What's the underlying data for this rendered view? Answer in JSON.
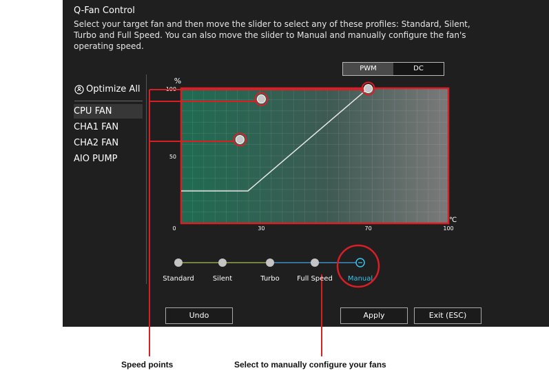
{
  "header": {
    "title": "Q-Fan Control",
    "description": "Select your target fan and then move the slider to select any of these profiles: Standard, Silent, Turbo and Full Speed. You can also move the slider to Manual and manually configure the fan's operating speed."
  },
  "mode_toggle": {
    "pwm": "PWM",
    "dc": "DC",
    "selected": "PWM"
  },
  "optimize_all": {
    "label": "Optimize All",
    "icon": "fan-icon"
  },
  "fans": [
    {
      "label": "CPU FAN",
      "selected": true
    },
    {
      "label": "CHA1 FAN",
      "selected": false
    },
    {
      "label": "CHA2 FAN",
      "selected": false
    },
    {
      "label": "AIO PUMP",
      "selected": false
    }
  ],
  "chart_data": {
    "type": "line",
    "y_unit": "%",
    "x_unit": "℃",
    "x_ticks": [
      "0",
      "30",
      "70",
      "100"
    ],
    "y_ticks": [
      "100",
      "50"
    ],
    "xlim": [
      0,
      100
    ],
    "ylim": [
      0,
      100
    ],
    "speed_points": [
      {
        "temp": 22,
        "speed": 62
      },
      {
        "temp": 30,
        "speed": 92
      },
      {
        "temp": 70,
        "speed": 100
      }
    ],
    "profile_curve": [
      [
        0,
        24
      ],
      [
        25,
        24
      ],
      [
        70,
        100
      ]
    ],
    "colors": {
      "plot_green": "#1f6b52",
      "plot_grey": "#777777",
      "border": "#d91f26",
      "curve": "#e8e8e8"
    }
  },
  "profiles": {
    "items": [
      "Standard",
      "Silent",
      "Turbo",
      "Full Speed",
      "Manual"
    ],
    "selected": "Manual"
  },
  "buttons": {
    "undo": "Undo",
    "apply": "Apply",
    "exit": "Exit (ESC)"
  },
  "callouts": {
    "speed_points": "Speed points",
    "manual": "Select to manually configure your fans"
  },
  "colors": {
    "accent_red": "#d91f26",
    "accent_cyan": "#3cc4ef",
    "panel_bg": "#1f1f1f"
  }
}
